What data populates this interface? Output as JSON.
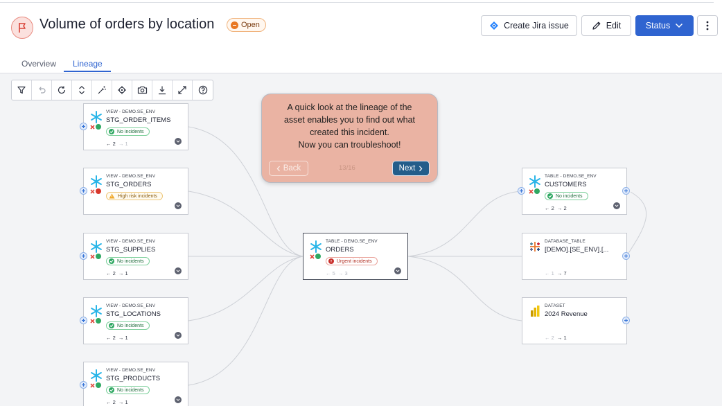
{
  "header": {
    "title": "Volume of orders by location",
    "status_badge": "Open",
    "buttons": {
      "jira": "Create Jira issue",
      "edit": "Edit",
      "status": "Status"
    }
  },
  "tabs": [
    {
      "label": "Overview",
      "active": false
    },
    {
      "label": "Lineage",
      "active": true
    }
  ],
  "toolbar": {
    "tools": [
      "filter-icon",
      "undo-icon",
      "reset-icon",
      "expand-collapse-icon",
      "auto-layout-icon",
      "center-icon",
      "screenshot-icon",
      "download-icon",
      "fullscreen-icon",
      "help-icon"
    ]
  },
  "lineage": {
    "upstream": [
      {
        "type": "VIEW - DEMO.SE_ENV",
        "name": "STG_ORDER_ITEMS",
        "incidents": "No incidents",
        "level": "ok",
        "in": "2",
        "out": "1"
      },
      {
        "type": "VIEW - DEMO.SE_ENV",
        "name": "STG_ORDERS",
        "incidents": "High risk incidents",
        "level": "warn",
        "in": "",
        "out": ""
      },
      {
        "type": "VIEW - DEMO.SE_ENV",
        "name": "STG_SUPPLIES",
        "incidents": "No incidents",
        "level": "ok",
        "in": "2",
        "out": "1"
      },
      {
        "type": "VIEW - DEMO.SE_ENV",
        "name": "STG_LOCATIONS",
        "incidents": "No incidents",
        "level": "ok",
        "in": "2",
        "out": "1"
      },
      {
        "type": "VIEW - DEMO.SE_ENV",
        "name": "STG_PRODUCTS",
        "incidents": "No incidents",
        "level": "ok",
        "in": "2",
        "out": "1"
      }
    ],
    "center": {
      "type": "TABLE - DEMO.SE_ENV",
      "name": "ORDERS",
      "incidents": "Urgent incidents",
      "level": "urg",
      "in": "5",
      "out": "3"
    },
    "downstream": [
      {
        "type": "TABLE - DEMO.SE_ENV",
        "name": "CUSTOMERS",
        "incidents": "No incidents",
        "level": "ok",
        "in": "2",
        "out": "2"
      },
      {
        "type": "DATABASE_TABLE",
        "name": "[DEMO].[SE_ENV].[...",
        "incidents": "",
        "level": "",
        "in": "1",
        "out": "7"
      },
      {
        "type": "DATASET",
        "name": "2024 Revenue",
        "incidents": "",
        "level": "",
        "in": "2",
        "out": "1"
      }
    ]
  },
  "tour": {
    "message": "A quick look at the lineage of the\nasset enables you to find out what\ncreated this incident.\nNow you can troubleshoot!",
    "back_label": "Back",
    "step": "13/16",
    "next_label": "Next"
  },
  "colors": {
    "accent": "#2f64d0",
    "tour_bg": "#eab3a3",
    "tour_next": "#235d8a",
    "open_badge": "#e87722"
  }
}
